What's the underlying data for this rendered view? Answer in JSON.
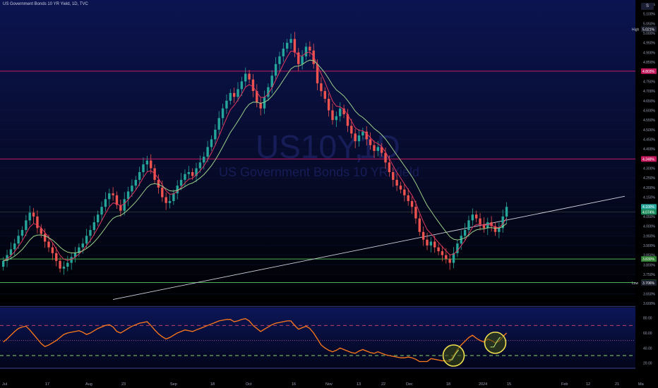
{
  "header": {
    "title": "US Government Bonds 10 YR Yield, 1D, TVC",
    "scale_button": "S"
  },
  "watermark": {
    "symbol": "US10Y,",
    "sub": "1D",
    "desc": "US Government Bonds 10 YR Yield"
  },
  "colors": {
    "up": "#26a69a",
    "down": "#ef5350",
    "ema_fast": "#e0395f",
    "ema_slow": "#9ad08a",
    "rsi": "#ff7a1a",
    "hline_red": "#c2185b",
    "hline_green": "#4caf50",
    "trendline": "#cfd2dc",
    "highlight": "#f0e050"
  },
  "chart_data": [
    {
      "type": "candlestick",
      "title": "US Government Bonds 10 YR Yield, 1D, TVC",
      "y_axis_ticks": [
        "5.150%",
        "5.100%",
        "5.050%",
        "5.000%",
        "4.950%",
        "4.900%",
        "4.850%",
        "4.800%",
        "4.750%",
        "4.700%",
        "4.650%",
        "4.600%",
        "4.550%",
        "4.500%",
        "4.450%",
        "4.400%",
        "4.350%",
        "4.300%",
        "4.250%",
        "4.200%",
        "4.150%",
        "4.100%",
        "4.050%",
        "4.000%",
        "3.950%",
        "3.900%",
        "3.850%",
        "3.800%",
        "3.750%",
        "3.700%",
        "3.650%",
        "3.600%"
      ],
      "x_axis_ticks": [
        "Jul",
        "17",
        "Aug",
        "23",
        "Sep",
        "18",
        "Oct",
        "16",
        "Nov",
        "13",
        "22",
        "Dec",
        "18",
        "2024",
        "15",
        "Feb",
        "12",
        "21",
        "Ma"
      ],
      "ylim": [
        3.6,
        5.15
      ],
      "price_labels": [
        {
          "name": "High",
          "value": "5.021%"
        },
        {
          "name": "",
          "value": "4.803%"
        },
        {
          "name": "",
          "value": "4.348%"
        },
        {
          "name": "",
          "value": "4.100%"
        },
        {
          "name": "",
          "value": "4.074%"
        },
        {
          "name": "",
          "value": "3.830%"
        },
        {
          "name": "",
          "value": "3.708%"
        },
        {
          "name": "Low",
          "value": "3.706%"
        }
      ],
      "horizontal_levels": [
        4.803,
        4.348,
        3.83,
        3.708
      ],
      "trendline": {
        "from": {
          "index": 0,
          "value": 3.62
        },
        "to": {
          "index": 134,
          "value": 4.155
        }
      },
      "closes": [
        3.82,
        3.85,
        3.88,
        3.91,
        3.95,
        3.98,
        4.03,
        4.07,
        4.05,
        3.99,
        3.96,
        3.92,
        3.89,
        3.86,
        3.82,
        3.78,
        3.79,
        3.81,
        3.84,
        3.86,
        3.89,
        3.91,
        3.95,
        3.98,
        4.02,
        4.06,
        4.1,
        4.14,
        4.17,
        4.16,
        4.11,
        4.08,
        4.14,
        4.18,
        4.21,
        4.24,
        4.28,
        4.32,
        4.34,
        4.3,
        4.24,
        4.2,
        4.15,
        4.12,
        4.13,
        4.17,
        4.21,
        4.24,
        4.27,
        4.28,
        4.26,
        4.3,
        4.33,
        4.36,
        4.41,
        4.45,
        4.5,
        4.56,
        4.61,
        4.65,
        4.69,
        4.67,
        4.71,
        4.75,
        4.79,
        4.76,
        4.7,
        4.64,
        4.61,
        4.67,
        4.72,
        4.78,
        4.84,
        4.88,
        4.92,
        4.95,
        4.97,
        4.9,
        4.84,
        4.88,
        4.93,
        4.91,
        4.84,
        4.74,
        4.7,
        4.66,
        4.6,
        4.55,
        4.57,
        4.61,
        4.58,
        4.52,
        4.48,
        4.44,
        4.47,
        4.49,
        4.45,
        4.42,
        4.39,
        4.41,
        4.38,
        4.33,
        4.28,
        4.24,
        4.21,
        4.19,
        4.16,
        4.13,
        4.1,
        4.04,
        3.97,
        3.93,
        3.9,
        3.92,
        3.89,
        3.87,
        3.85,
        3.83,
        3.81,
        3.86,
        3.91,
        3.95,
        3.98,
        4.03,
        4.06,
        4.04,
        4.01,
        3.99,
        4.02,
        4.0,
        3.97,
        3.99,
        4.05,
        4.1
      ]
    },
    {
      "type": "line",
      "title": "",
      "y_axis_ticks": [
        "80.00",
        "60.00",
        "40.00",
        "20.00"
      ],
      "ylim": [
        15,
        90
      ],
      "levels": [
        70,
        50,
        30
      ],
      "highlight_indices": [
        119,
        130
      ],
      "series": [
        {
          "values": [
            48,
            52,
            57,
            62,
            66,
            68,
            69,
            64,
            58,
            52,
            46,
            42,
            44,
            47,
            50,
            54,
            58,
            60,
            61,
            62,
            63,
            61,
            58,
            60,
            63,
            66,
            68,
            70,
            71,
            68,
            62,
            60,
            63,
            66,
            69,
            71,
            73,
            74,
            75,
            70,
            64,
            59,
            55,
            52,
            54,
            57,
            60,
            62,
            64,
            63,
            62,
            64,
            66,
            68,
            70,
            72,
            74,
            76,
            77,
            78,
            78,
            75,
            76,
            78,
            79,
            76,
            70,
            66,
            62,
            65,
            68,
            71,
            73,
            74,
            75,
            76,
            76,
            70,
            65,
            67,
            69,
            66,
            60,
            52,
            44,
            40,
            37,
            35,
            37,
            40,
            38,
            36,
            34,
            33,
            36,
            38,
            36,
            34,
            33,
            35,
            33,
            31,
            30,
            29,
            28,
            27,
            27,
            28,
            27,
            25,
            22,
            22,
            22,
            26,
            25,
            24,
            23,
            23,
            22,
            30,
            38,
            44,
            49,
            54,
            57,
            53,
            50,
            48,
            52,
            50,
            47,
            49,
            55,
            60
          ]
        }
      ]
    }
  ]
}
